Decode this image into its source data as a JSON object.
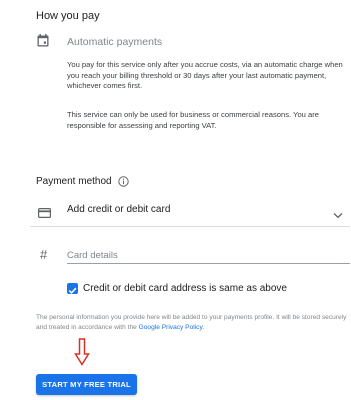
{
  "section": {
    "title": "How you pay",
    "payment_type": "Automatic payments",
    "description_1": "You pay for this service only after you accrue costs, via an automatic charge when you reach your billing threshold or 30 days after your last automatic payment, whichever comes first.",
    "description_2": "This service can only be used for business or commercial reasons. You are responsible for assessing and reporting VAT."
  },
  "payment_method": {
    "title": "Payment method",
    "add_card_label": "Add credit or debit card",
    "card_details_placeholder": "Card details",
    "hash_symbol": "#",
    "same_address_label": "Credit or debit card address is same as above",
    "same_address_checked": true
  },
  "privacy": {
    "text": "The personal information you provide here will be added to your payments profile. It will be stored securely and treated in accordance with the ",
    "link_text": "Google Privacy Policy",
    "suffix": "."
  },
  "cta": {
    "label": "START MY FREE TRIAL"
  },
  "colors": {
    "accent": "#1a73e8",
    "arrow": "#d93025"
  },
  "icons": {
    "calendar": "calendar-icon",
    "info": "info-icon",
    "card": "credit-card-icon",
    "chevron": "chevron-down-icon",
    "checkbox": "checkbox-checked-icon",
    "arrow": "arrow-down-icon"
  }
}
